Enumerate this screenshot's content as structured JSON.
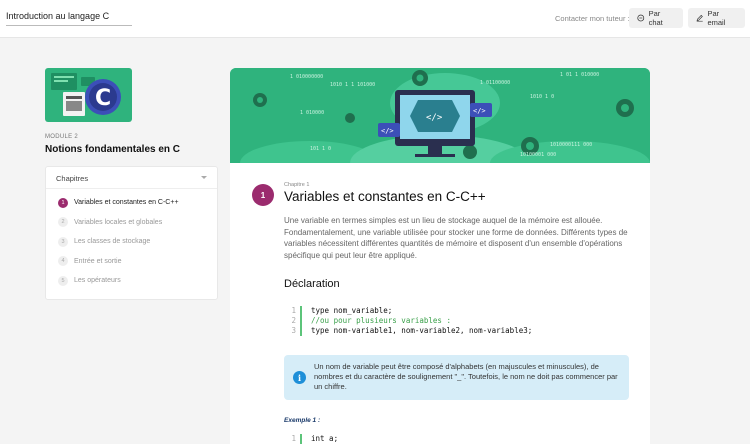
{
  "header": {
    "course_title": "Introduction au langage C",
    "contact_label": "Contacter mon tuteur :",
    "chat_label": "Par chat",
    "email_label": "Par email"
  },
  "module": {
    "label": "MODULE 2",
    "title": "Notions fondamentales en C"
  },
  "chapters": {
    "heading": "Chapitres",
    "items": [
      {
        "num": "1",
        "label": "Variables et constantes en C-C++"
      },
      {
        "num": "2",
        "label": "Variables locales et globales"
      },
      {
        "num": "3",
        "label": "Les classes de stockage"
      },
      {
        "num": "4",
        "label": "Entrée et sortie"
      },
      {
        "num": "5",
        "label": "Les opérateurs"
      }
    ]
  },
  "content": {
    "chapter_label": "Chapitre 1",
    "chapter_num": "1",
    "title": "Variables et constantes en C-C++",
    "intro": "Une variable en termes simples est un lieu de stockage auquel de la mémoire est allouée. Fondamentalement, une variable utilisée pour stocker une forme de données. Différents types de variables nécessitent différentes quantités de mémoire et disposent d'un ensemble d'opérations spécifique qui peut leur être appliqué.",
    "section_title": "Déclaration",
    "code1": [
      {
        "ln": "1",
        "text": "type nom_variable;"
      },
      {
        "ln": "2",
        "text": "//ou pour plusieurs variables :"
      },
      {
        "ln": "3",
        "text": "type nom-variable1, nom-variable2, nom-variable3;"
      }
    ],
    "info_text": "Un nom de variable peut être composé d'alphabets (en majuscules et minuscules), de nombres et du caractère de soulignement \"_\". Toutefois, le nom ne doit pas commencer par un chiffre.",
    "example_label": "Exemple 1 :",
    "code2": [
      {
        "ln": "1",
        "text": "int a;"
      }
    ]
  },
  "banner_binary": [
    "1 010000000",
    "1010 1 1 101000",
    "1 01100000",
    "1 01 1 010000",
    "1 010000",
    "1010 1 0",
    "101 1 0",
    "1010000111 000",
    "10100001 000"
  ],
  "colors": {
    "accent": "#9b2b6e",
    "brand_green": "#2fb37d",
    "info_bg": "#d6edf8",
    "info_icon": "#1e8fd8"
  }
}
